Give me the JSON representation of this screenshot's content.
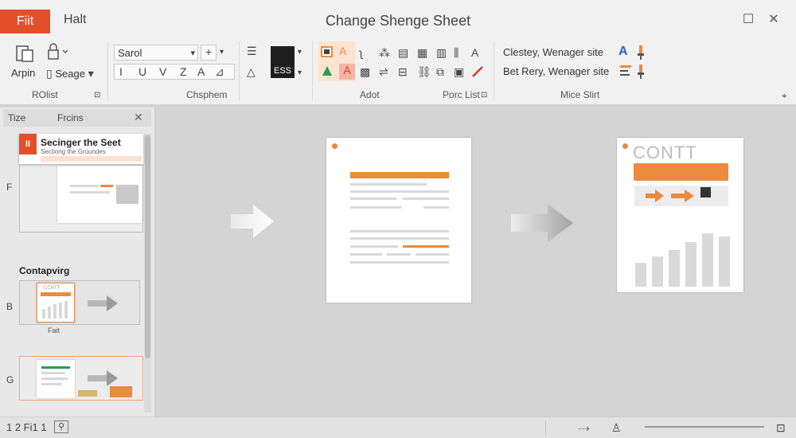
{
  "titlebar": {
    "file_tab": "Fiit",
    "halt_tab": "Halt",
    "window_title": "Change Shenge Sheet",
    "restore_glyph": "☐",
    "close_glyph": "✕"
  },
  "ribbon": {
    "btn_arpin": "Arpin",
    "btn_seage": "Seage",
    "font_name": "Sarol",
    "font_plus": "+",
    "format_glyphs": [
      "I",
      "U",
      "V",
      "Z",
      "A"
    ],
    "big_btn": "ESS",
    "line1_text": "Clestey, Wenager site",
    "line2_text": "Bet Rery, Wenager site",
    "groups": {
      "g1": "ROlist",
      "g2": "Chsphem",
      "g3": "Adot",
      "g4": "Porc List",
      "g5": "Mice Slirt"
    },
    "accent": "#ec8a3e",
    "blue": "#2d62c7",
    "green": "#23a04b"
  },
  "leftpane": {
    "tab1": "Tize",
    "tab2": "Frcins",
    "slide1_heading": "Secinger the Seet",
    "slide1_sub": "Sectiong the Groundes",
    "slide1_badge": "II",
    "section_label": "Contapvirg",
    "slide2_caption": "Fait",
    "slide2_thumb_title": "CCNTT",
    "num1": "F",
    "num2": "B",
    "num3": "G"
  },
  "canvas": {
    "slide3_title": "CONTT"
  },
  "statusbar": {
    "page_info": "1 2 Fi1 1"
  }
}
